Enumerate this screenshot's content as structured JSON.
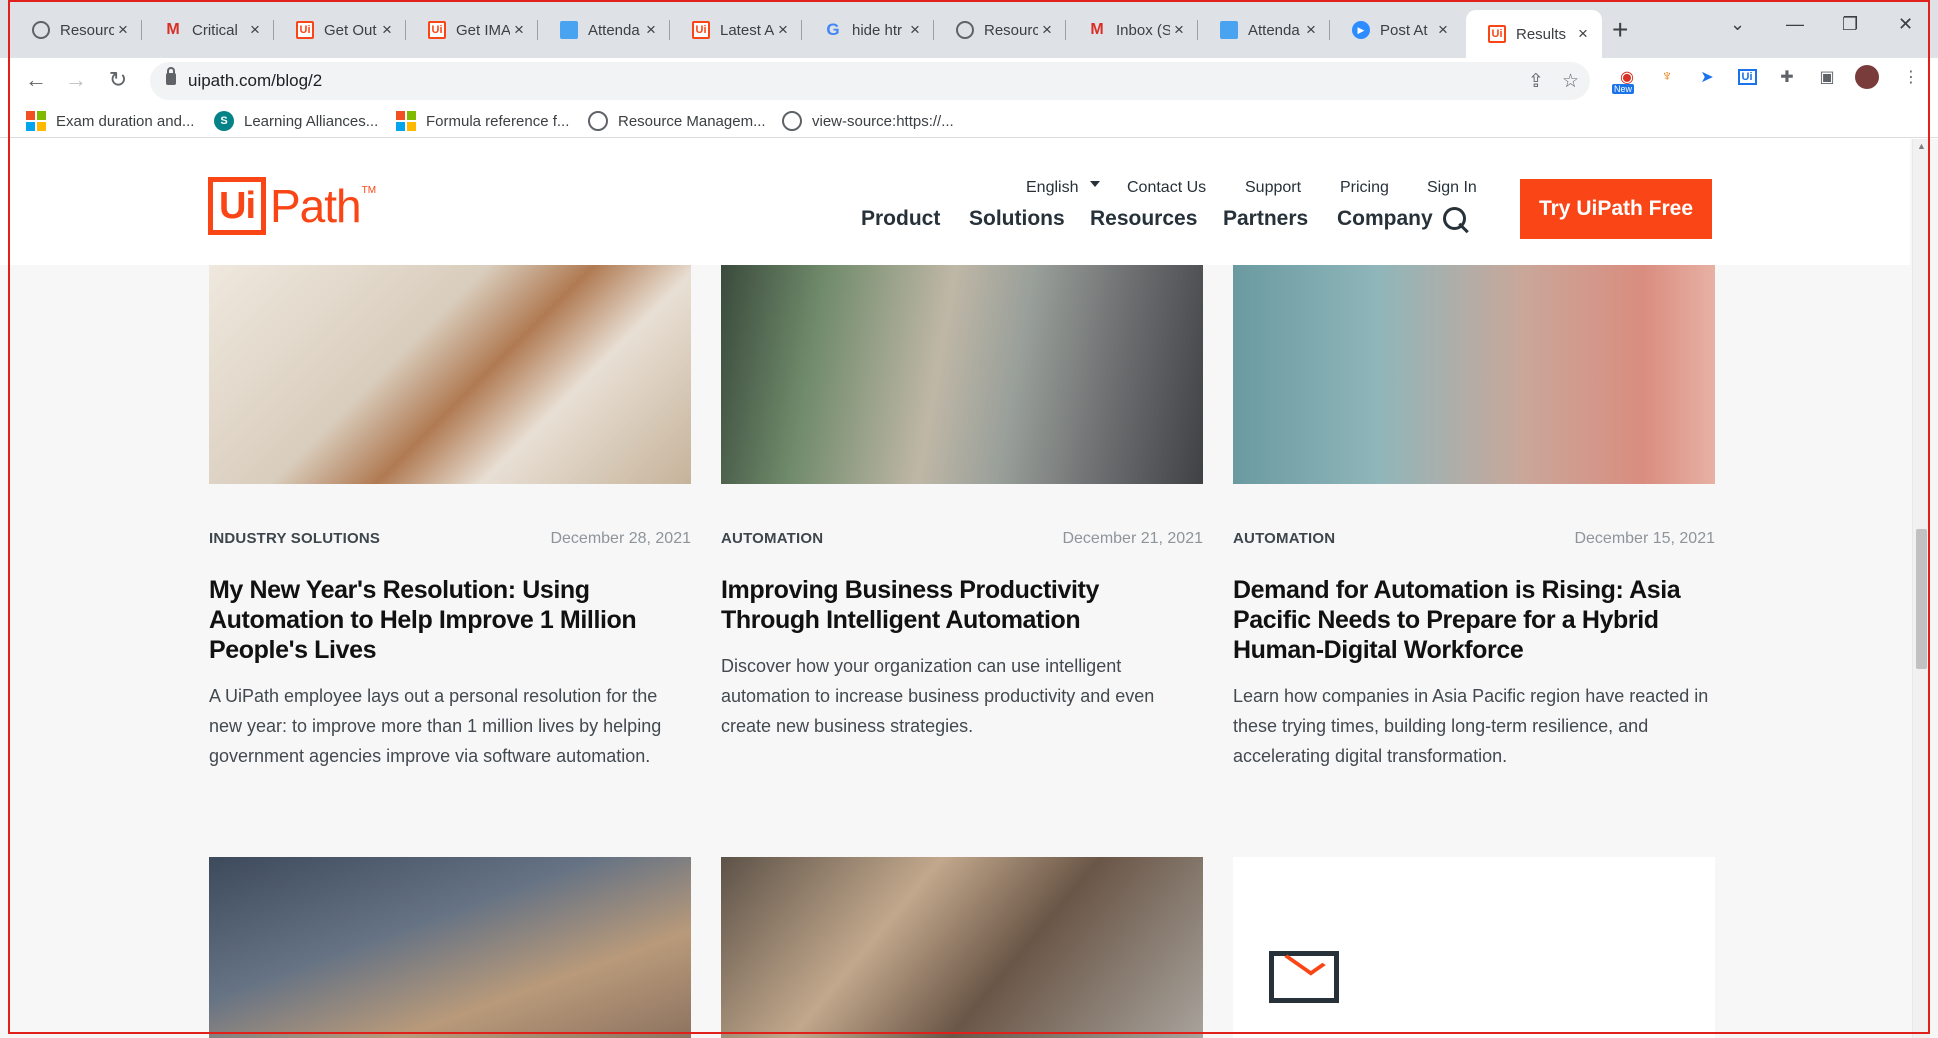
{
  "browser": {
    "tabs": [
      {
        "label": "Resourc",
        "icon": "globe-icon"
      },
      {
        "label": "Critical",
        "icon": "gmail-icon"
      },
      {
        "label": "Get Out",
        "icon": "uipath-icon"
      },
      {
        "label": "Get IMA",
        "icon": "uipath-icon"
      },
      {
        "label": "Attenda",
        "icon": "doc-icon"
      },
      {
        "label": "Latest A",
        "icon": "uipath-icon"
      },
      {
        "label": "hide htr",
        "icon": "google-icon"
      },
      {
        "label": "Resourc",
        "icon": "globe-icon"
      },
      {
        "label": "Inbox (S",
        "icon": "gmail-icon"
      },
      {
        "label": "Attenda",
        "icon": "doc-icon"
      },
      {
        "label": "Post At",
        "icon": "zoom-icon"
      },
      {
        "label": "Results",
        "icon": "uipath-icon",
        "active": true
      }
    ],
    "tab_close": "×",
    "new_tab": "+",
    "url": "uipath.com/blog/2",
    "bookmarks": [
      {
        "label": "Exam duration and...",
        "icon": "microsoft-icon"
      },
      {
        "label": "Learning Alliances...",
        "icon": "sharepoint-icon"
      },
      {
        "label": "Formula reference f...",
        "icon": "microsoft-icon"
      },
      {
        "label": "Resource Managem...",
        "icon": "globe-icon"
      },
      {
        "label": "view-source:https://...",
        "icon": "globe-icon"
      }
    ],
    "extension_badge": "New"
  },
  "site": {
    "logo_box": "Ui",
    "logo_text": "Path",
    "logo_tm": "TM",
    "util_nav": {
      "language": "English",
      "contact": "Contact Us",
      "support": "Support",
      "pricing": "Pricing",
      "signin": "Sign In"
    },
    "main_nav": [
      "Product",
      "Solutions",
      "Resources",
      "Partners",
      "Company"
    ],
    "cta": "Try UiPath Free"
  },
  "posts": [
    {
      "category": "INDUSTRY SOLUTIONS",
      "date": "December 28, 2021",
      "title": "My New Year's Resolution: Using Automation to Help Improve 1 Million People's Lives",
      "description": "A UiPath employee lays out a personal resolution for the new year: to improve more than 1 million lives by helping government agencies improve via software automation."
    },
    {
      "category": "AUTOMATION",
      "date": "December 21, 2021",
      "title": "Improving Business Productivity Through Intelligent Automation",
      "description": "Discover how your organization can use intelligent automation to increase business productivity and even create new business strategies."
    },
    {
      "category": "AUTOMATION",
      "date": "December 15, 2021",
      "title": "Demand for Automation is Rising: Asia Pacific Needs to Prepare for a Hybrid Human-Digital Workforce",
      "description": "Learn how companies in Asia Pacific region have reacted in these trying times, building long-term resilience, and accelerating digital transformation."
    }
  ],
  "colors": {
    "brand": "#fa4616",
    "text_dark": "#273139",
    "page_bg": "#f7f7f7"
  }
}
